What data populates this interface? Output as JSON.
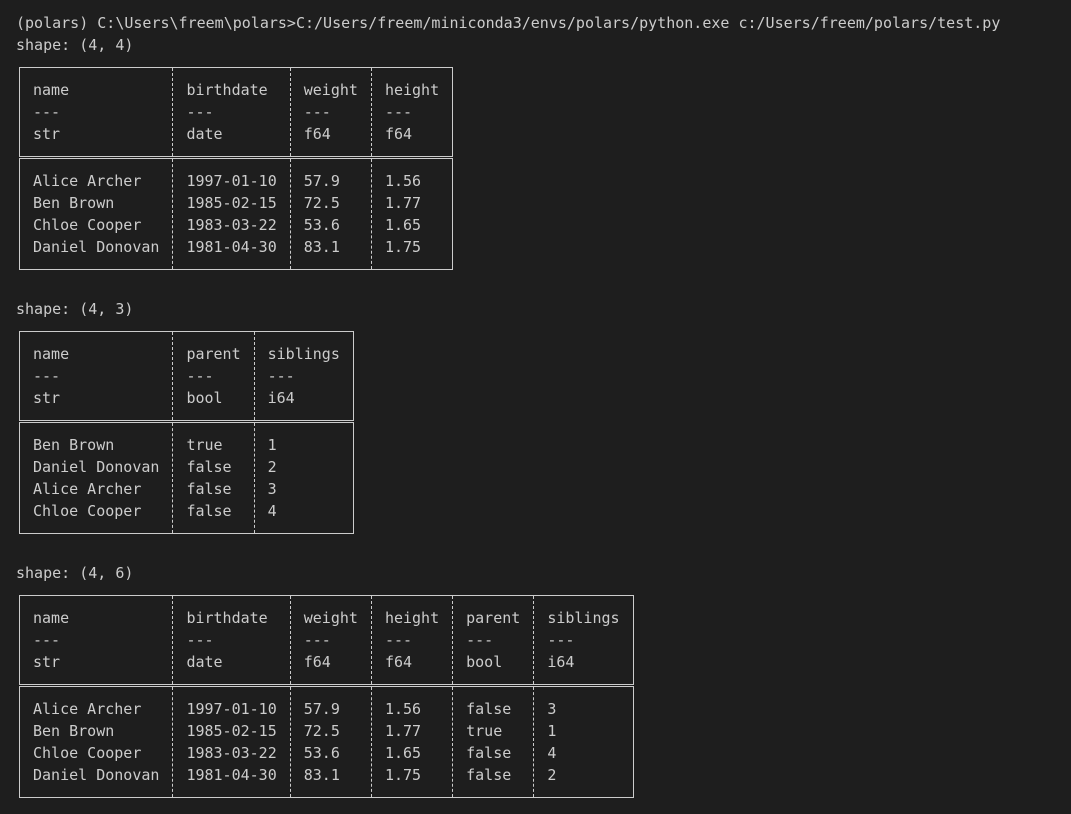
{
  "terminal": {
    "prompt_line": "(polars) C:\\Users\\freem\\polars>C:/Users/freem/miniconda3/envs/polars/python.exe c:/Users/freem/polars/test.py"
  },
  "tables": [
    {
      "shape_line": "shape: (4, 4)",
      "columns": [
        {
          "name": "name",
          "dtype": "str"
        },
        {
          "name": "birthdate",
          "dtype": "date"
        },
        {
          "name": "weight",
          "dtype": "f64"
        },
        {
          "name": "height",
          "dtype": "f64"
        }
      ],
      "rows": [
        [
          "Alice Archer",
          "1997-01-10",
          "57.9",
          "1.56"
        ],
        [
          "Ben Brown",
          "1985-02-15",
          "72.5",
          "1.77"
        ],
        [
          "Chloe Cooper",
          "1983-03-22",
          "53.6",
          "1.65"
        ],
        [
          "Daniel Donovan",
          "1981-04-30",
          "83.1",
          "1.75"
        ]
      ]
    },
    {
      "shape_line": "shape: (4, 3)",
      "columns": [
        {
          "name": "name",
          "dtype": "str"
        },
        {
          "name": "parent",
          "dtype": "bool"
        },
        {
          "name": "siblings",
          "dtype": "i64"
        }
      ],
      "rows": [
        [
          "Ben Brown",
          "true",
          "1"
        ],
        [
          "Daniel Donovan",
          "false",
          "2"
        ],
        [
          "Alice Archer",
          "false",
          "3"
        ],
        [
          "Chloe Cooper",
          "false",
          "4"
        ]
      ]
    },
    {
      "shape_line": "shape: (4, 6)",
      "columns": [
        {
          "name": "name",
          "dtype": "str"
        },
        {
          "name": "birthdate",
          "dtype": "date"
        },
        {
          "name": "weight",
          "dtype": "f64"
        },
        {
          "name": "height",
          "dtype": "f64"
        },
        {
          "name": "parent",
          "dtype": "bool"
        },
        {
          "name": "siblings",
          "dtype": "i64"
        }
      ],
      "rows": [
        [
          "Alice Archer",
          "1997-01-10",
          "57.9",
          "1.56",
          "false",
          "3"
        ],
        [
          "Ben Brown",
          "1985-02-15",
          "72.5",
          "1.77",
          "true",
          "1"
        ],
        [
          "Chloe Cooper",
          "1983-03-22",
          "53.6",
          "1.65",
          "false",
          "4"
        ],
        [
          "Daniel Donovan",
          "1981-04-30",
          "83.1",
          "1.75",
          "false",
          "2"
        ]
      ]
    }
  ],
  "header_separator": "---"
}
